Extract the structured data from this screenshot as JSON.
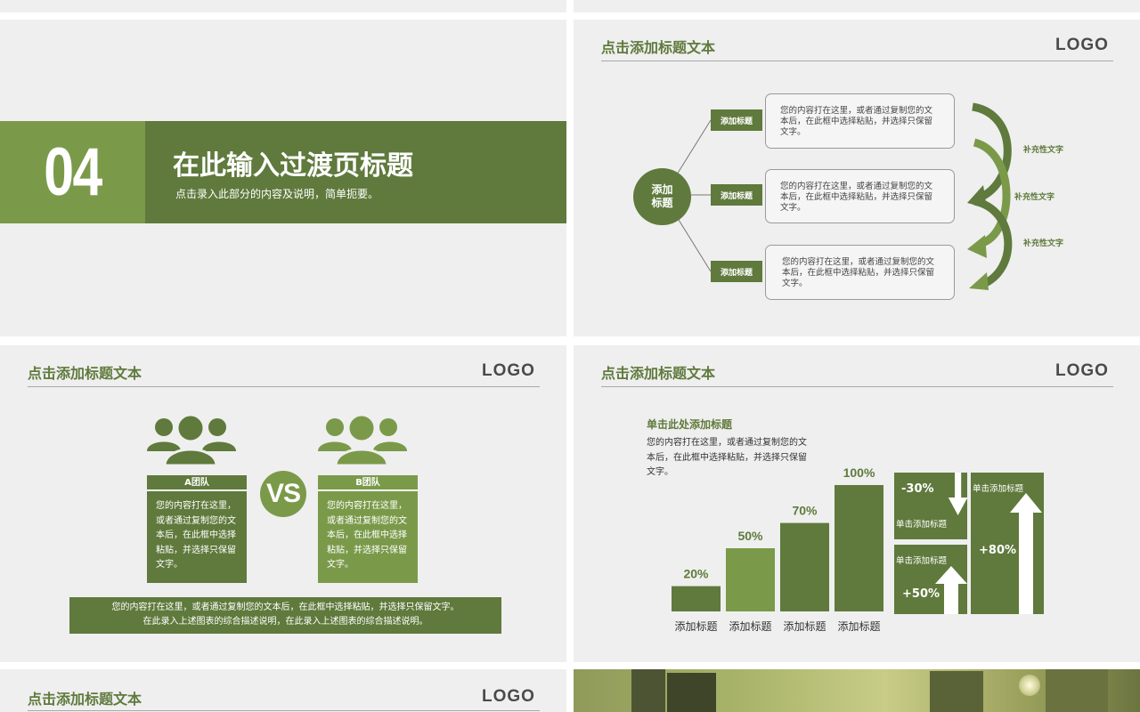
{
  "slide_top_left": {},
  "slide_top_right": {},
  "transition": {
    "number": "04",
    "title": "在此输入过渡页标题",
    "subtitle": "点击录入此部分的内容及说明，简单扼要。"
  },
  "common": {
    "header_title": "点击添加标题文本",
    "logo": "LOGO",
    "body_text": "您的内容打在这里，或者通过复制您的文本后，在此框中选择粘贴，并选择只保留文字。"
  },
  "mindmap": {
    "center": [
      "添加",
      "标题"
    ],
    "branch_label": "添加标题",
    "boxes": [
      "您的内容打在这里，或者通过复制您的文本后，在此框中选择粘贴，并选择只保留文字。",
      "您的内容打在这里，或者通过复制您的文本后，在此框中选择粘贴，并选择只保留文字。",
      "您的内容打在这里，或者通过复制您的文本后，在此框中选择粘贴，并选择只保留文字。"
    ],
    "supplements": [
      "补充性文字",
      "补充性文字",
      "补充性文字"
    ]
  },
  "versus": {
    "team_a": "A团队",
    "team_b": "B团队",
    "vs": "VS",
    "team_a_text": "您的内容打在这里，或者通过复制您的文本后，在此框中选择粘贴，并选择只保留文字。",
    "team_b_text": "您的内容打在这里，或者通过复制您的文本后，在此框中选择粘贴，并选择只保留文字。",
    "summary_line1": "您的内容打在这里，或者通过复制您的文本后，在此框中选择粘贴，并选择只保留文字。",
    "summary_line2": "在此录入上述图表的综合描述说明，在此录入上述图表的综合描述说明。"
  },
  "bars": {
    "subtitle": "单击此处添加标题",
    "text": "您的内容打在这里，或者通过复制您的文本后，在此框中选择粘贴，并选择只保留文字。",
    "arrow_label": "单击添加标题",
    "arrow_values": [
      "-30%",
      "+50%",
      "+80%"
    ]
  },
  "chart_data": {
    "type": "bar",
    "categories": [
      "添加标题",
      "添加标题",
      "添加标题",
      "添加标题"
    ],
    "values": [
      20,
      50,
      70,
      100
    ],
    "value_labels": [
      "20%",
      "50%",
      "70%",
      "100%"
    ],
    "ylim": [
      0,
      100
    ],
    "colors": [
      "#5f7a3c",
      "#7a9a4a",
      "#5f7a3c",
      "#5f7a3c"
    ]
  },
  "slide_bottom_left": {},
  "colors": {
    "accent": "#5f7a3c",
    "accent_light": "#7a9a4a",
    "background": "#efefef"
  }
}
